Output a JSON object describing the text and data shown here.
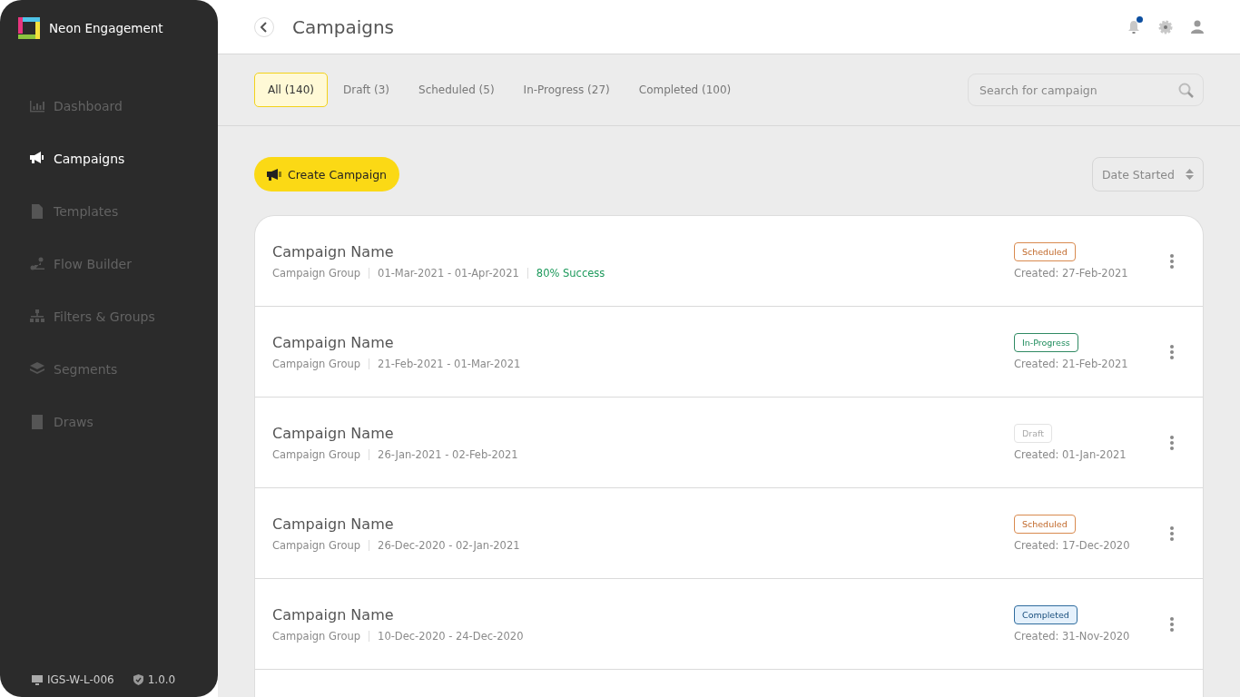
{
  "app": {
    "name": "Neon Engagement"
  },
  "sidebar": {
    "items": [
      {
        "label": "Dashboard",
        "selected": false
      },
      {
        "label": "Campaigns",
        "selected": true
      },
      {
        "label": "Templates",
        "selected": false
      },
      {
        "label": "Flow Builder",
        "selected": false
      },
      {
        "label": "Filters & Groups",
        "selected": false
      },
      {
        "label": "Segments",
        "selected": false
      },
      {
        "label": "Draws",
        "selected": false
      }
    ],
    "footer": {
      "machine": "IGS-W-L-006",
      "version": "1.0.0"
    }
  },
  "header": {
    "title": "Campaigns",
    "notification_unread": true
  },
  "filter_tabs": [
    {
      "label": "All (140)",
      "selected": true
    },
    {
      "label": "Draft (3)",
      "selected": false
    },
    {
      "label": "Scheduled (5)",
      "selected": false
    },
    {
      "label": "In-Progress (27)",
      "selected": false
    },
    {
      "label": "Completed (100)",
      "selected": false
    }
  ],
  "search": {
    "placeholder": "Search for campaign"
  },
  "create_button": "Create Campaign",
  "sort": {
    "value": "Date Started"
  },
  "campaigns": [
    {
      "name": "Campaign Name",
      "group": "Campaign Group",
      "dates": "01-Mar-2021 - 01-Apr-2021",
      "success": "80% Success",
      "kind": "scheduled",
      "status_label": "Scheduled",
      "created": "Created: 27-Feb-2021"
    },
    {
      "name": "Campaign Name",
      "group": "Campaign Group",
      "dates": "21-Feb-2021 - 01-Mar-2021",
      "kind": "in_progress",
      "status_label": "In-Progress",
      "created": "Created: 21-Feb-2021"
    },
    {
      "name": "Campaign Name",
      "group": "Campaign Group",
      "dates": "26-Jan-2021 - 02-Feb-2021",
      "kind": "draft",
      "status_label": "Draft",
      "created": "Created: 01-Jan-2021"
    },
    {
      "name": "Campaign Name",
      "group": "Campaign Group",
      "dates": "26-Dec-2020 - 02-Jan-2021",
      "kind": "scheduled",
      "status_label": "Scheduled",
      "created": "Created: 17-Dec-2020"
    },
    {
      "name": "Campaign Name",
      "group": "Campaign Group",
      "dates": "10-Dec-2020 - 24-Dec-2020",
      "kind": "completed",
      "status_label": "Completed",
      "created": "Created: 31-Nov-2020"
    }
  ]
}
